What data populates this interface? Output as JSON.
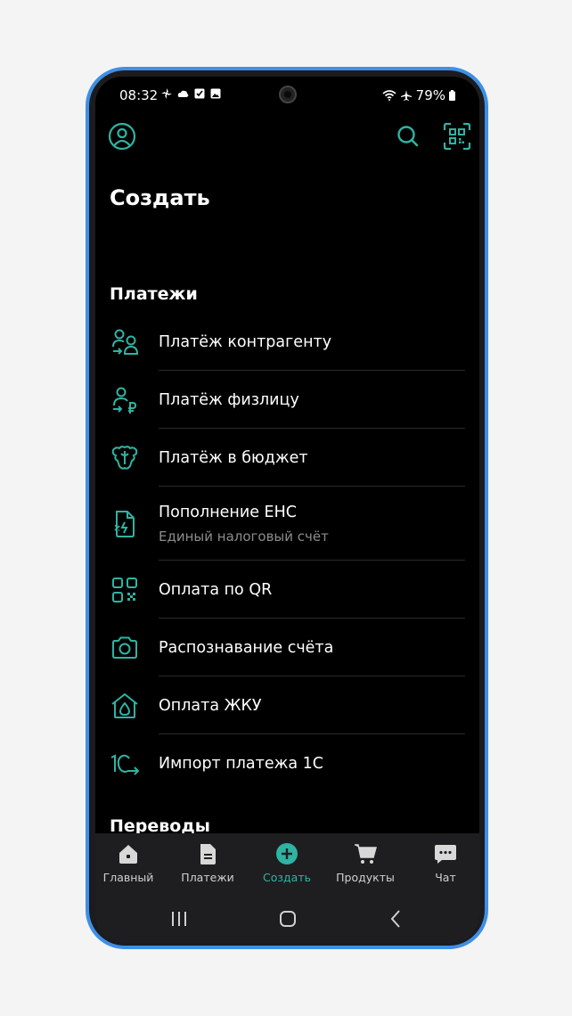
{
  "status_bar": {
    "time": "08:32",
    "battery": "79%"
  },
  "header": {
    "title": "Создать"
  },
  "sections": {
    "payments": "Платежи",
    "transfers": "Переводы"
  },
  "menu": {
    "items": [
      {
        "label": "Платёж контрагенту",
        "icon": "counterparty-payment-icon"
      },
      {
        "label": "Платёж физлицу",
        "icon": "individual-payment-icon"
      },
      {
        "label": "Платёж в бюджет",
        "icon": "budget-payment-icon"
      },
      {
        "label": "Пополнение ЕНС",
        "sublabel": "Единый налоговый счёт",
        "icon": "tax-document-icon"
      },
      {
        "label": "Оплата по QR",
        "icon": "qr-code-icon"
      },
      {
        "label": "Распознавание счёта",
        "icon": "camera-icon"
      },
      {
        "label": "Оплата ЖКУ",
        "icon": "house-drop-icon"
      },
      {
        "label": "Импорт платежа 1С",
        "icon": "import-1c-icon"
      }
    ]
  },
  "bottom_nav": {
    "items": [
      {
        "label": "Главный",
        "icon": "home-icon"
      },
      {
        "label": "Платежи",
        "icon": "document-icon"
      },
      {
        "label": "Создать",
        "icon": "add-circle-icon",
        "active": true
      },
      {
        "label": "Продукты",
        "icon": "cart-icon"
      },
      {
        "label": "Чат",
        "icon": "chat-icon"
      }
    ]
  },
  "colors": {
    "accent": "#2fb3a3",
    "background": "#000000",
    "frame": "#3e8fe6"
  }
}
